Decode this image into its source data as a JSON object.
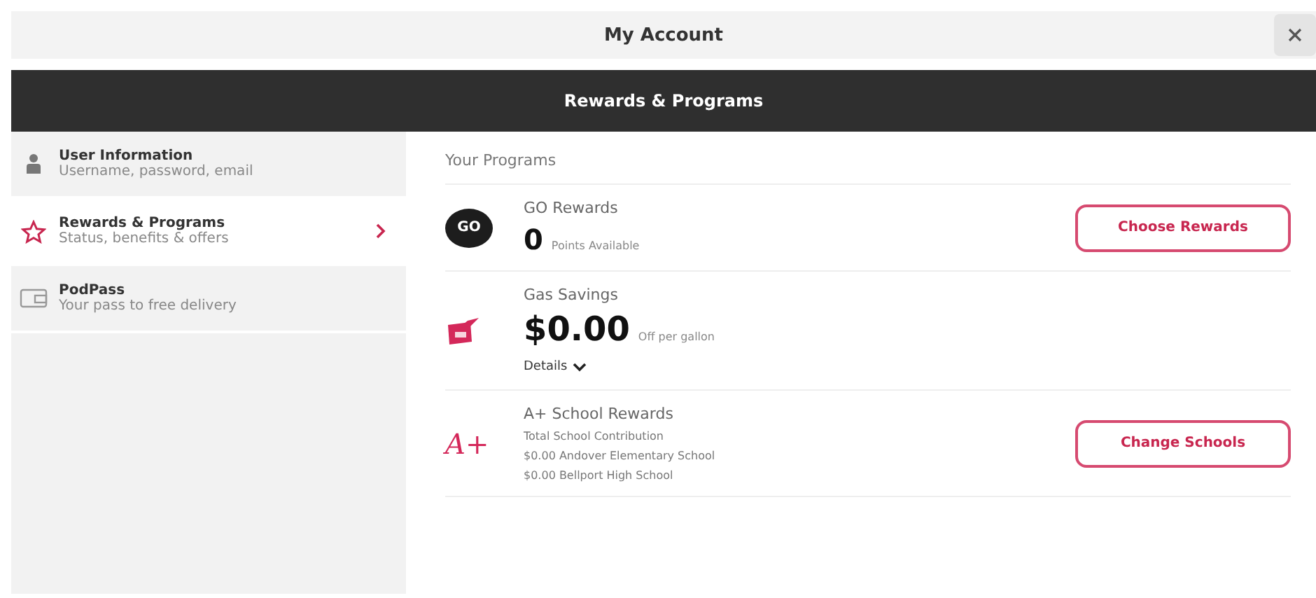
{
  "window": {
    "title": "My Account"
  },
  "section_bar": {
    "title": "Rewards & Programs"
  },
  "sidebar": {
    "items": [
      {
        "kind": "person",
        "title": "User Information",
        "subtitle": "Username, password, email",
        "selected": false
      },
      {
        "kind": "star",
        "title": "Rewards & Programs",
        "subtitle": "Status, benefits & offers",
        "selected": true
      },
      {
        "kind": "card",
        "title": "PodPass",
        "subtitle": "Your pass to free delivery",
        "selected": false
      }
    ]
  },
  "content": {
    "heading": "Your Programs",
    "programs": [
      {
        "kind": "go",
        "logo_text": "GO",
        "name": "GO Rewards",
        "value": "0",
        "value_note": "Points Available",
        "button": "Choose Rewards"
      },
      {
        "kind": "gas",
        "name": "Gas Savings",
        "value": "$0.00",
        "value_note": "Off per gallon",
        "link": "Details"
      },
      {
        "kind": "school",
        "logo_text": "A+",
        "name": "A+ School Rewards",
        "lines": [
          "Total School Contribution",
          "$0.00 Andover Elementary School",
          "$0.00 Bellport High School"
        ],
        "button": "Change Schools"
      }
    ]
  }
}
